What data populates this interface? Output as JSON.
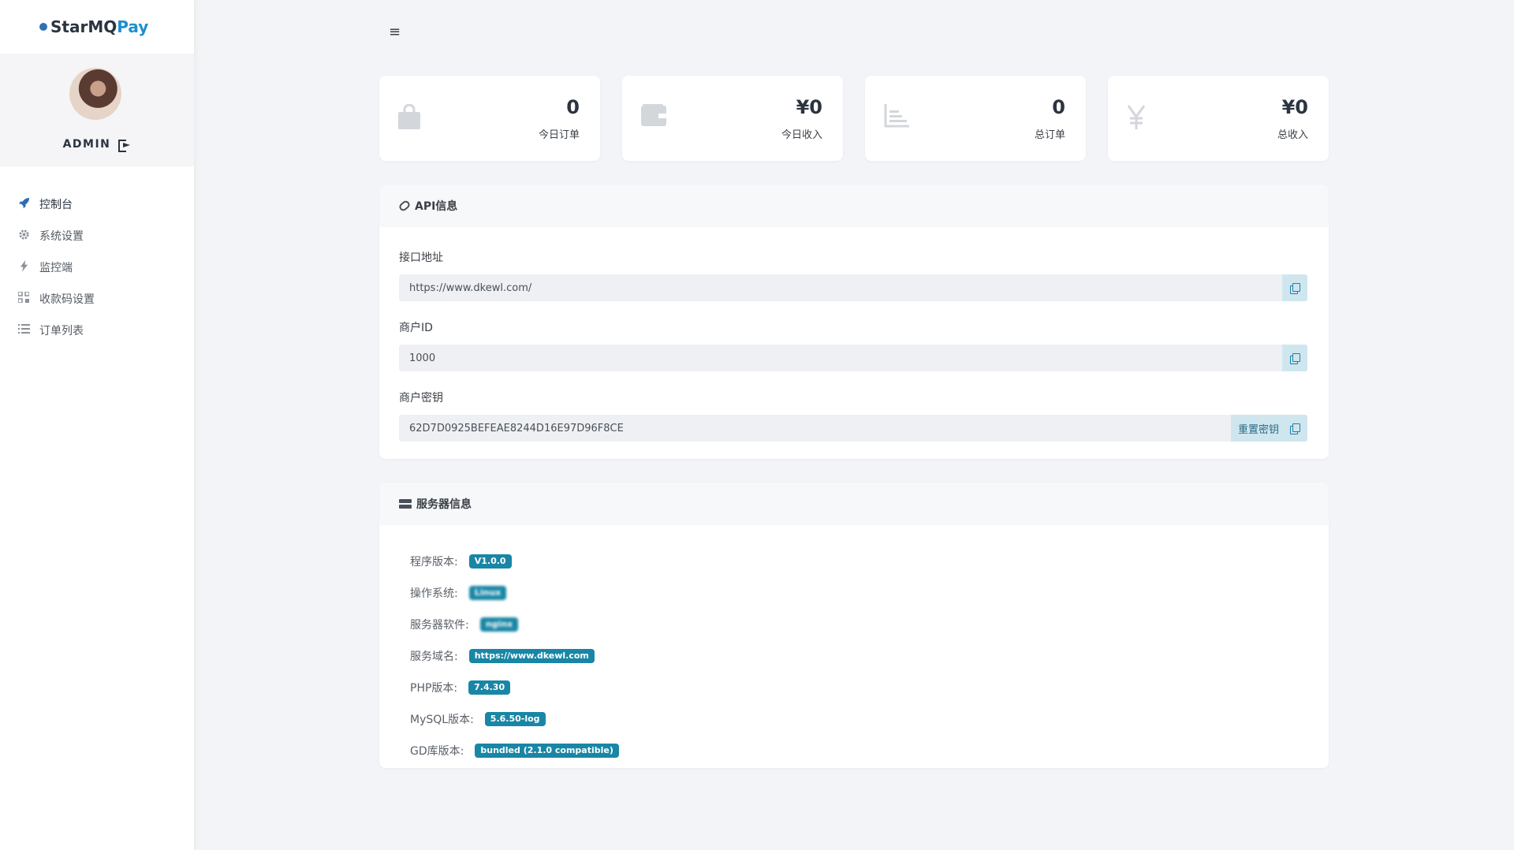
{
  "brand": {
    "part1": "StarMQ",
    "part2": "Pay"
  },
  "user": {
    "name": "ADMIN"
  },
  "menu_toggle": "≡",
  "nav": [
    {
      "label": "控制台",
      "icon": "rocket-icon"
    },
    {
      "label": "系统设置",
      "icon": "gear-icon"
    },
    {
      "label": "监控端",
      "icon": "bolt-icon"
    },
    {
      "label": "收款码设置",
      "icon": "qrcode-icon"
    },
    {
      "label": "订单列表",
      "icon": "list-icon"
    }
  ],
  "stats": [
    {
      "value": "0",
      "label": "今日订单",
      "icon": "shopping-bag-icon"
    },
    {
      "value": "¥0",
      "label": "今日收入",
      "icon": "wallet-icon"
    },
    {
      "value": "0",
      "label": "总订单",
      "icon": "chart-icon"
    },
    {
      "value": "¥0",
      "label": "总收入",
      "icon": "yen-icon"
    }
  ],
  "api": {
    "title": "API信息",
    "endpoint_label": "接口地址",
    "endpoint_value": "https://www.dkewl.com/",
    "merchant_id_label": "商户ID",
    "merchant_id_value": "1000",
    "merchant_key_label": "商户密钥",
    "merchant_key_value": "62D7D0925BEFEAE8244D16E97D96F8CE",
    "reset_label": "重置密钥"
  },
  "server": {
    "title": "服务器信息",
    "rows": [
      {
        "label": "程序版本:",
        "value": "V1.0.0"
      },
      {
        "label": "操作系统:",
        "value": "Linux"
      },
      {
        "label": "服务器软件:",
        "value": "nginx"
      },
      {
        "label": "服务域名:",
        "value": "https://www.dkewl.com"
      },
      {
        "label": "PHP版本:",
        "value": "7.4.30"
      },
      {
        "label": "MySQL版本:",
        "value": "5.6.50-log"
      },
      {
        "label": "GD库版本:",
        "value": "bundled (2.1.0 compatible)"
      }
    ]
  },
  "colors": {
    "accent": "#1986a5",
    "brand_blue": "#1d8fd0",
    "copy_bg": "#cfe6ef"
  }
}
